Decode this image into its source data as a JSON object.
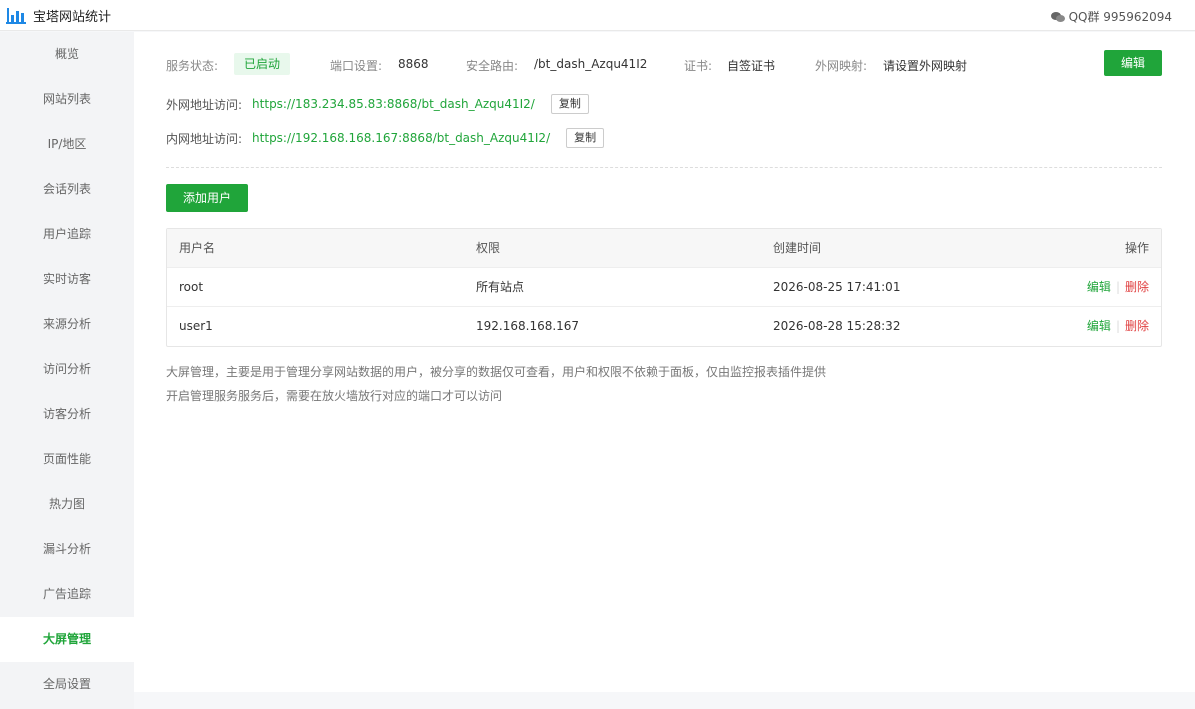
{
  "app": {
    "title": "宝塔网站统计",
    "qq_label": "QQ群 995962094"
  },
  "sidebar": {
    "items": [
      {
        "label": "概览"
      },
      {
        "label": "网站列表"
      },
      {
        "label": "IP/地区"
      },
      {
        "label": "会话列表"
      },
      {
        "label": "用户追踪"
      },
      {
        "label": "实时访客"
      },
      {
        "label": "来源分析"
      },
      {
        "label": "访问分析"
      },
      {
        "label": "访客分析"
      },
      {
        "label": "页面性能"
      },
      {
        "label": "热力图"
      },
      {
        "label": "漏斗分析"
      },
      {
        "label": "广告追踪"
      },
      {
        "label": "大屏管理"
      },
      {
        "label": "全局设置"
      }
    ],
    "active_index": 13
  },
  "status": {
    "service_label": "服务状态:",
    "service_value": "已启动",
    "port_label": "端口设置:",
    "port_value": "8868",
    "route_label": "安全路由:",
    "route_value": "/bt_dash_Azqu41I2",
    "cert_label": "证书:",
    "cert_value": "自签证书",
    "mapping_label": "外网映射:",
    "mapping_value": "请设置外网映射",
    "edit_label": "编辑"
  },
  "urls": {
    "public_label": "外网地址访问:",
    "public_url": "https://183.234.85.83:8868/bt_dash_Azqu41I2/",
    "private_label": "内网地址访问:",
    "private_url": "https://192.168.168.167:8868/bt_dash_Azqu41I2/",
    "copy_label": "复制"
  },
  "add_user_label": "添加用户",
  "table": {
    "headers": [
      "用户名",
      "权限",
      "创建时间",
      "操作"
    ],
    "rows": [
      {
        "username": "root",
        "permission": "所有站点",
        "created": "2026-08-25 17:41:01"
      },
      {
        "username": "user1",
        "permission": "192.168.168.167",
        "created": "2026-08-28 15:28:32"
      }
    ],
    "edit_label": "编辑",
    "delete_label": "删除",
    "sep": "|"
  },
  "notes": [
    "大屏管理，主要是用于管理分享网站数据的用户，被分享的数据仅可查看，用户和权限不依赖于面板，仅由监控报表插件提供",
    "开启管理服务服务后，需要在放火墙放行对应的端口才可以访问"
  ],
  "colors": {
    "brand": "#20a53a",
    "danger": "#e04040"
  }
}
